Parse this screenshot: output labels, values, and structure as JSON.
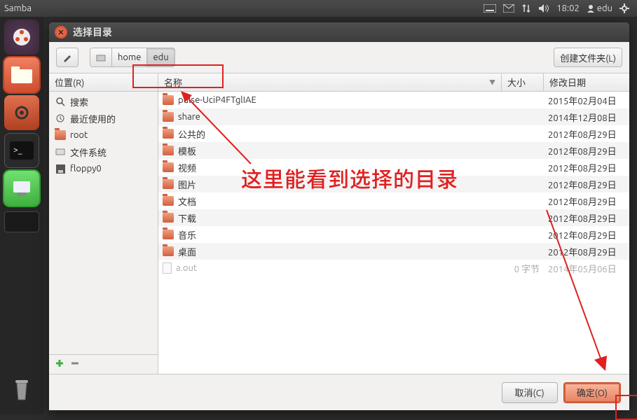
{
  "panel": {
    "app_title": "Samba",
    "time": "18:02",
    "user": "edu"
  },
  "launcher": {
    "items": [
      "ubuntu-dash",
      "files",
      "settings",
      "terminal",
      "samba",
      "workspace"
    ],
    "trash": "trash"
  },
  "dialog": {
    "title": "选择目录",
    "toolbar": {
      "pencil_tip": "输入位置",
      "path": [
        "home",
        "edu"
      ],
      "create_folder": "创建文件夹(L)"
    },
    "sidebar": {
      "header": "位置(R)",
      "items": [
        {
          "icon": "search",
          "label": "搜索"
        },
        {
          "icon": "recent",
          "label": "最近使用的"
        },
        {
          "icon": "folder",
          "label": "root"
        },
        {
          "icon": "drive",
          "label": "文件系统"
        },
        {
          "icon": "floppy",
          "label": "floppy0"
        }
      ]
    },
    "columns": {
      "name": "名称",
      "size": "大小",
      "date": "修改日期"
    },
    "rows": [
      {
        "type": "folder",
        "name": "pulse-UciP4FTglIAE",
        "size": "",
        "date": "2015年02月04日"
      },
      {
        "type": "folder",
        "name": "share",
        "size": "",
        "date": "2014年12月08日"
      },
      {
        "type": "folder",
        "name": "公共的",
        "size": "",
        "date": "2012年08月29日"
      },
      {
        "type": "folder",
        "name": "模板",
        "size": "",
        "date": "2012年08月29日"
      },
      {
        "type": "folder",
        "name": "视频",
        "size": "",
        "date": "2012年08月29日"
      },
      {
        "type": "folder",
        "name": "图片",
        "size": "",
        "date": "2012年08月29日"
      },
      {
        "type": "folder",
        "name": "文档",
        "size": "",
        "date": "2012年08月29日"
      },
      {
        "type": "folder",
        "name": "下载",
        "size": "",
        "date": "2012年08月29日"
      },
      {
        "type": "folder",
        "name": "音乐",
        "size": "",
        "date": "2012年08月29日"
      },
      {
        "type": "folder",
        "name": "桌面",
        "size": "",
        "date": "2012年08月29日"
      },
      {
        "type": "file",
        "name": "a.out",
        "size": "0 字节",
        "date": "2014年05月06日",
        "dim": true
      }
    ],
    "buttons": {
      "cancel": "取消(C)",
      "ok": "确定(O)"
    }
  },
  "annotation": {
    "text": "这里能看到选择的目录"
  }
}
